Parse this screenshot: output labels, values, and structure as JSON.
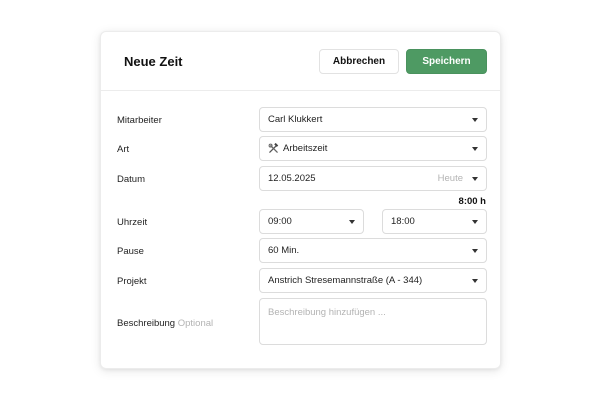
{
  "dialog": {
    "title": "Neue Zeit",
    "cancel_label": "Abbrechen",
    "save_label": "Speichern",
    "accent_color": "#4e9a63"
  },
  "form": {
    "employee": {
      "label": "Mitarbeiter",
      "value": "Carl Klukkert"
    },
    "type": {
      "label": "Art",
      "value": "Arbeitszeit",
      "icon": "hammer-wrench-icon"
    },
    "date": {
      "label": "Datum",
      "value": "12.05.2025",
      "hint": "Heute"
    },
    "duration": "8:00 h",
    "time": {
      "label": "Uhrzeit",
      "start": "09:00",
      "end": "18:00"
    },
    "pause": {
      "label": "Pause",
      "value": "60 Min."
    },
    "project": {
      "label": "Projekt",
      "value": "Anstrich Stresemannstraße (A - 344)"
    },
    "description": {
      "label": "Beschreibung",
      "optional": "Optional",
      "placeholder": "Beschreibung hinzufügen ..."
    }
  }
}
